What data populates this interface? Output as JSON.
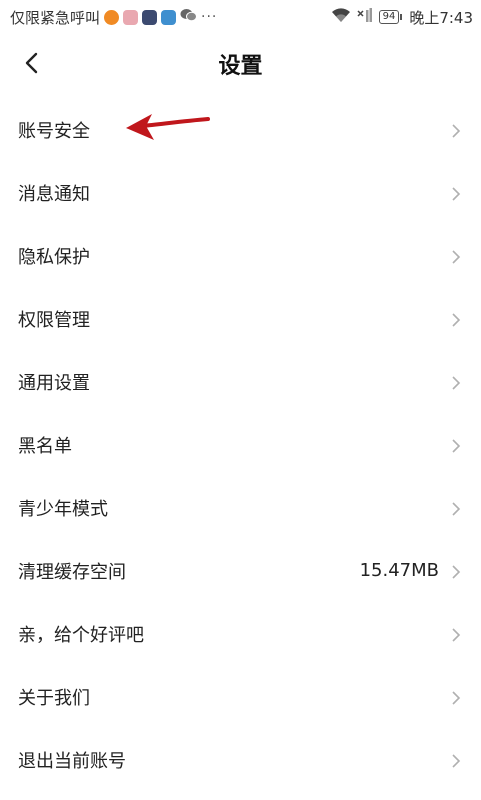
{
  "status_bar": {
    "left_text": "仅限紧急呼叫",
    "more": "···",
    "battery": "94",
    "time": "晚上7:43",
    "app_icon_colors": [
      "#f08a24",
      "#e9a8b0",
      "#3c4a70",
      "#3f8fcf"
    ],
    "wechat_color": "#666666"
  },
  "header": {
    "back_icon": "chevron-left-icon",
    "title": "设置"
  },
  "settings": {
    "items": [
      {
        "label": "账号安全",
        "value": ""
      },
      {
        "label": "消息通知",
        "value": ""
      },
      {
        "label": "隐私保护",
        "value": ""
      },
      {
        "label": "权限管理",
        "value": ""
      },
      {
        "label": "通用设置",
        "value": ""
      },
      {
        "label": "黑名单",
        "value": ""
      },
      {
        "label": "青少年模式",
        "value": ""
      },
      {
        "label": "清理缓存空间",
        "value": "15.47MB"
      },
      {
        "label": "亲，给个好评吧",
        "value": ""
      },
      {
        "label": "关于我们",
        "value": ""
      },
      {
        "label": "退出当前账号",
        "value": ""
      }
    ],
    "chevron_icon": "chevron-right-icon",
    "chevron_color": "#b0b0b0"
  },
  "annotation": {
    "arrow_color": "#c0171c"
  }
}
